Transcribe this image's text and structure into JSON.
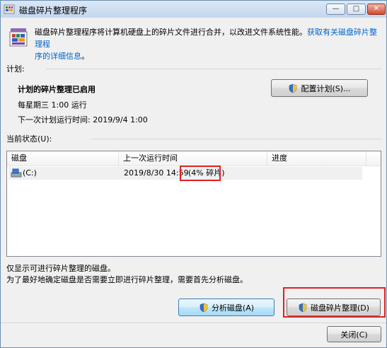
{
  "window": {
    "title": "磁盘碎片整理程序",
    "controls": {
      "minimize": "—",
      "maximize": "□",
      "close": "✕"
    }
  },
  "description": {
    "text": "磁盘碎片整理程序将计算机硬盘上的碎片文件进行合并，以改进文件系统性能。",
    "link_line1": "获取有关磁盘碎片整理程",
    "link_line2": "序的详细信息",
    "trailing": "。"
  },
  "schedule": {
    "section_label": "计划:",
    "status": "计划的碎片整理已启用",
    "frequency": "每星期三  1:00 运行",
    "next_run": "下一次计划运行时间: 2019/9/4 1:00",
    "configure_button": "配置计划(S)..."
  },
  "current_status": {
    "section_label": "当前状态(U):",
    "columns": [
      "磁盘",
      "上一次运行时间",
      "进度"
    ],
    "rows": [
      {
        "disk": "(C:)",
        "last_run": "2019/8/30 14:59",
        "fragmented": "(4% 碎片)",
        "progress": ""
      }
    ]
  },
  "notes": {
    "line1": "仅显示可进行碎片整理的磁盘。",
    "line2": "为了最好地确定磁盘是否需要立即进行碎片整理，需要首先分析磁盘。"
  },
  "buttons": {
    "analyze": "分析磁盘(A)",
    "defragment": "磁盘碎片整理(D)",
    "close": "关闭(C)"
  },
  "colors": {
    "link": "#0066cc",
    "highlight": "#e02020"
  }
}
